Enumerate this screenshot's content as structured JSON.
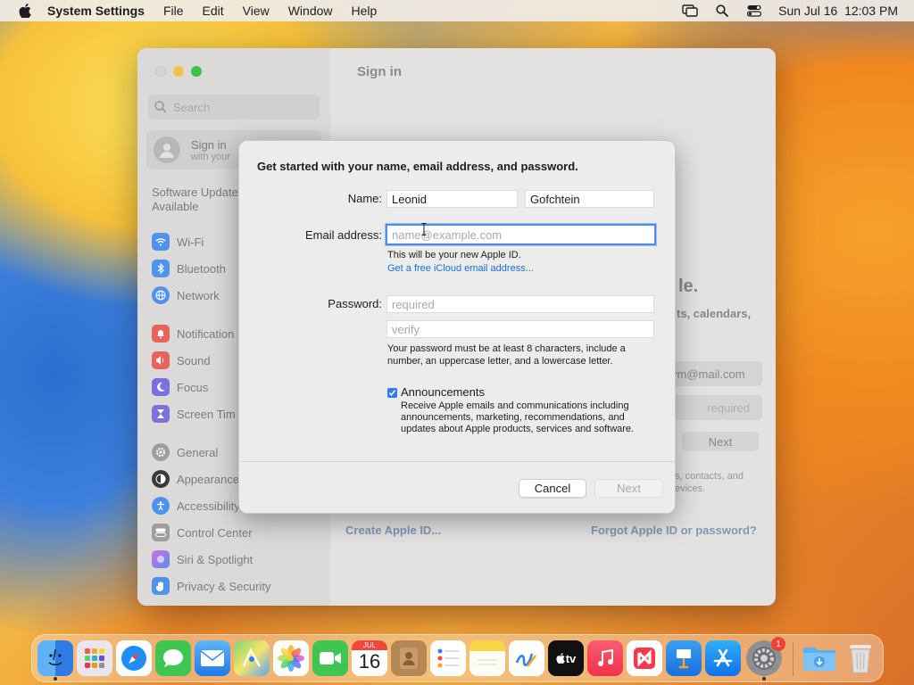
{
  "menubar": {
    "app_name": "System Settings",
    "menus": [
      "File",
      "Edit",
      "View",
      "Window",
      "Help"
    ],
    "clock": "Sun Jul 16  12:03 PM"
  },
  "window": {
    "title": "Sign in",
    "search_placeholder": "Search",
    "signin_title": "Sign in",
    "signin_subtitle": "with your",
    "software_update": [
      "Software Update",
      "Available"
    ],
    "sidebar_items": [
      {
        "label": "Wi-Fi",
        "color": "#3b8df0"
      },
      {
        "label": "Bluetooth",
        "color": "#3b8df0"
      },
      {
        "label": "Network",
        "color": "#3b8df0"
      },
      {
        "label": "Notification",
        "color": "#e8463b"
      },
      {
        "label": "Sound",
        "color": "#e8463b"
      },
      {
        "label": "Focus",
        "color": "#5a4fd6"
      },
      {
        "label": "Screen Tim",
        "color": "#5a4fd6"
      },
      {
        "label": "General",
        "color": "#8e8e93"
      },
      {
        "label": "Appearance",
        "color": "#1d1d1f"
      },
      {
        "label": "Accessibility",
        "color": "#3b8df0"
      },
      {
        "label": "Control Center",
        "color": "#8e8e93"
      },
      {
        "label": "Siri & Spotlight",
        "color": "#b04fd6"
      },
      {
        "label": "Privacy & Security",
        "color": "#3b8df0"
      }
    ],
    "right_pane": {
      "heading_fragment": "le.",
      "subheading_fragment": "ts, calendars,",
      "email_fragment": "ym@mail.com",
      "password_placeholder": "required",
      "next_label": "Next",
      "small_line1": "s, contacts, and",
      "small_line2": "evices.",
      "create_link": "Create Apple ID...",
      "forgot_link": "Forgot Apple ID or password?"
    }
  },
  "dialog": {
    "title": "Get started with your name, email address, and password.",
    "name_label": "Name:",
    "first_name": "Leonid",
    "last_name": "Gofchtein",
    "email_label": "Email address:",
    "email_placeholder": "name@example.com",
    "email_hint": "This will be your new Apple ID.",
    "icloud_link": "Get a free iCloud email address...",
    "password_label": "Password:",
    "password_placeholder": "required",
    "verify_placeholder": "verify",
    "password_hint_1": "Your password must be at least 8 characters, include a",
    "password_hint_2": "number, an uppercase letter, and a lowercase letter.",
    "announcements_label": "Announcements",
    "announcements_checked": true,
    "announcements_desc_1": "Receive Apple emails and communications including",
    "announcements_desc_2": "announcements, marketing, recommendations, and",
    "announcements_desc_3": "updates about Apple products, services and software.",
    "cancel_label": "Cancel",
    "next_label": "Next"
  },
  "dock": {
    "calendar_month": "JUL",
    "calendar_day": "16",
    "tv_label": "tv",
    "settings_badge": "1"
  }
}
